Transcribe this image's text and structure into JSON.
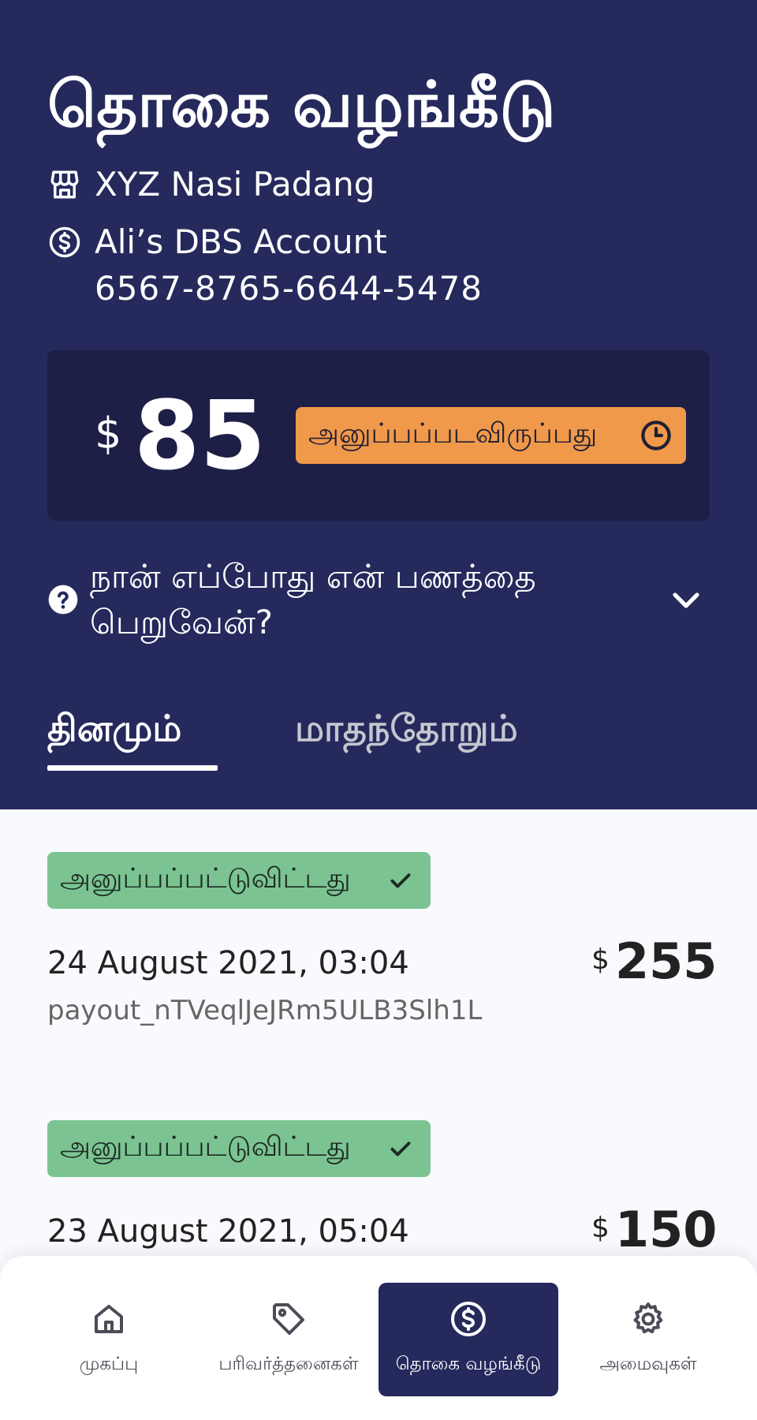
{
  "header": {
    "title": "தொகை வழங்கீடு",
    "store_name": "XYZ Nasi Padang",
    "account_name": "Ali’s DBS Account",
    "account_number": "6567-8765-6644-5478"
  },
  "balance": {
    "currency": "$",
    "amount": "85",
    "status": "அனுப்பப்படவிருப்பது"
  },
  "faq": {
    "question": "நான் எப்போது என் பணத்தை\nபெறுவேன்?"
  },
  "tabs": [
    {
      "label": "தினமும்",
      "active": true
    },
    {
      "label": "மாதந்தோறும்",
      "active": false
    }
  ],
  "payouts": [
    {
      "status": "அனுப்பப்பட்டுவிட்டது",
      "date": "24 August 2021, 03:04",
      "id": "payout_nTVeqlJeJRm5ULB3Slh1L",
      "currency": "$",
      "amount": "255"
    },
    {
      "status": "அனுப்பப்பட்டுவிட்டது",
      "date": "23 August 2021, 05:04",
      "id": "",
      "currency": "$",
      "amount": "150"
    }
  ],
  "nav": [
    {
      "label": "முகப்பு",
      "icon": "home-icon",
      "active": false
    },
    {
      "label": "பரிவர்த்தனைகள்",
      "icon": "tag-icon",
      "active": false
    },
    {
      "label": "தொகை வழங்கீடு",
      "icon": "dollar-circle-icon",
      "active": true
    },
    {
      "label": "அமைவுகள்",
      "icon": "gear-icon",
      "active": false
    }
  ],
  "colors": {
    "header_bg": "#25295c",
    "card_bg": "#1d1f47",
    "pending": "#f0994a",
    "sent": "#7bc492"
  }
}
